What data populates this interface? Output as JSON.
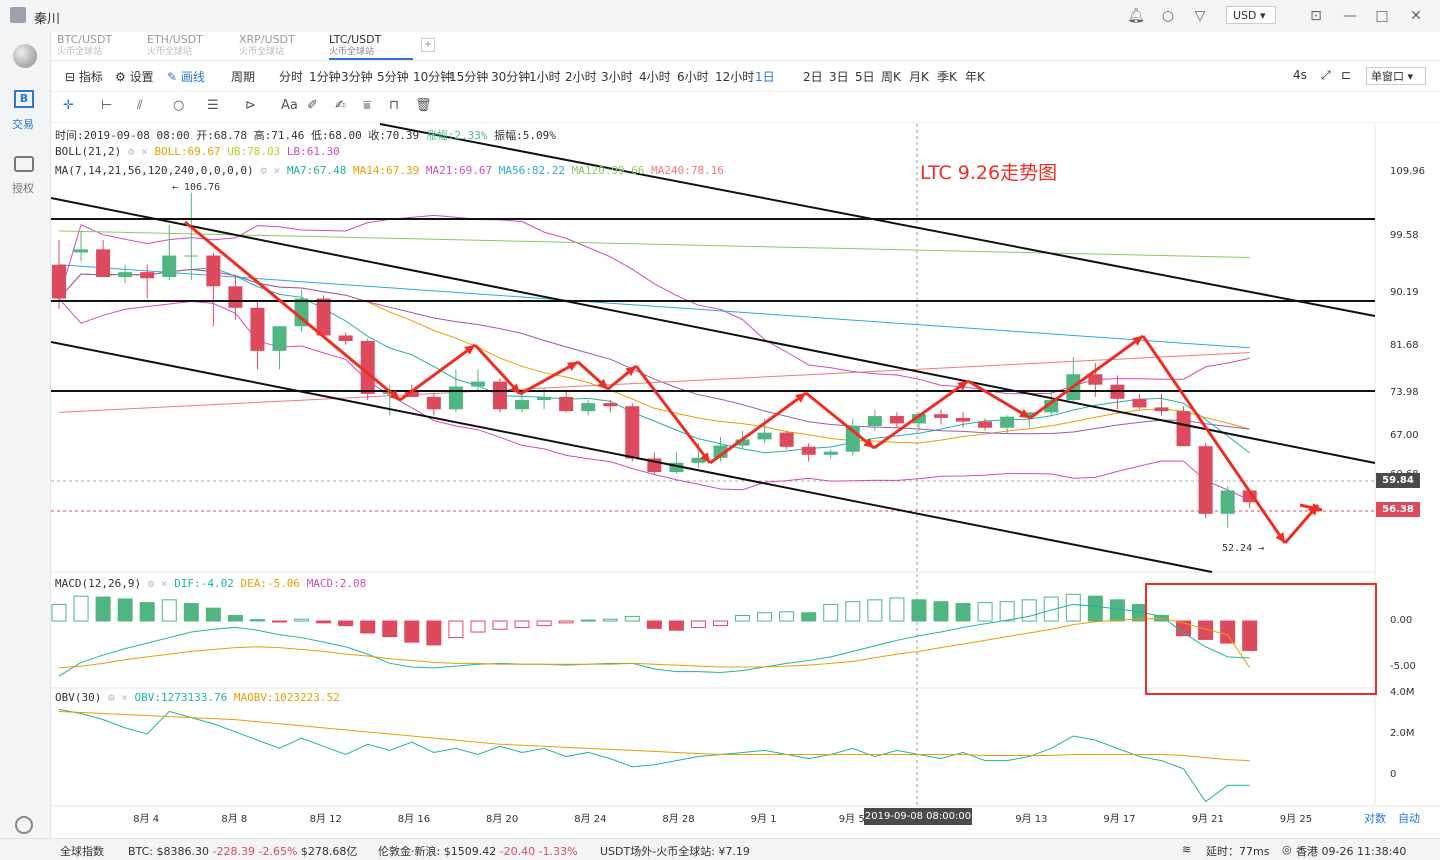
{
  "window": {
    "user": "秦川",
    "currency": "USD"
  },
  "sidebar": {
    "trade_label": "交易",
    "auth_label": "授权"
  },
  "tabs": [
    {
      "pair": "BTC/USDT",
      "exchange": "火币全球站"
    },
    {
      "pair": "ETH/USDT",
      "exchange": "火币全球站"
    },
    {
      "pair": "XRP/USDT",
      "exchange": "火币全球站"
    },
    {
      "pair": "LTC/USDT",
      "exchange": "火币全球站"
    }
  ],
  "toolbar": {
    "indicator": "指标",
    "settings": "设置",
    "draw": "画线",
    "period": "周期",
    "periods": [
      "分时",
      "1分钟",
      "3分钟",
      "5分钟",
      "10分钟",
      "15分钟",
      "30分钟",
      "1小时",
      "2小时",
      "3小时",
      "4小时",
      "6小时",
      "12小时",
      "1日",
      "2日",
      "3日",
      "5日",
      "周K",
      "月K",
      "季K",
      "年K"
    ],
    "active_period": "1日",
    "refresh": "4s",
    "window_mode": "单窗口"
  },
  "chart_data": {
    "type": "candlestick",
    "symbol": "LTC/USDT",
    "annotation": "LTC 9.26走势图",
    "info": {
      "time": "时间:2019-09-08 08:00",
      "open": "开:68.78",
      "high": "高:71.46",
      "low": "低:68.00",
      "close": "收:70.39",
      "change": "涨幅:2.33%",
      "amplitude": "振幅:5.09%"
    },
    "legends": {
      "boll": {
        "label": "BOLL(21,2)",
        "boll": "BOLL:69.67",
        "ub": "UB:78.03",
        "lb": "LB:61.30"
      },
      "ma": {
        "label": "MA(7,14,21,56,120,240,0,0,0,0)",
        "ma7": "MA7:67.48",
        "ma14": "MA14:67.39",
        "ma21": "MA21:69.67",
        "ma56": "MA56:82.22",
        "ma120": "MA120:99.66",
        "ma240": "MA240:78.16"
      },
      "macd": {
        "label": "MACD(12,26,9)",
        "dif": "DIF:-4.02",
        "dea": "DEA:-5.06",
        "macd": "MACD:2.08"
      },
      "obv": {
        "label": "OBV(30)",
        "obv": "OBV:1273133.76",
        "maobv": "MAOBV:1023223.52"
      }
    },
    "price_axis": [
      "109.96",
      "99.58",
      "90.19",
      "81.68",
      "73.98",
      "67.00",
      "60.68",
      "54.95"
    ],
    "price_tags": {
      "level": "59.84",
      "current": "56.38"
    },
    "high_label": "← 106.76",
    "low_label": "52.24 →",
    "macd_axis": [
      "0.00",
      "-5.00"
    ],
    "obv_axis": [
      "4.0M",
      "2.0M",
      "0"
    ],
    "x_axis": [
      "8月 4",
      "8月 8",
      "8月 12",
      "8月 16",
      "8月 20",
      "8月 24",
      "8月 28",
      "9月 1",
      "9月 5",
      "9月 13",
      "9月 17",
      "9月 21",
      "9月 25"
    ],
    "crosshair_label": "2019-09-08 08:00:00",
    "axis_buttons": {
      "log": "对数",
      "auto": "自动"
    },
    "candles": [
      [
        95.0,
        99.0,
        87.8,
        89.5
      ],
      [
        97.0,
        100.5,
        95.5,
        97.5
      ],
      [
        97.5,
        99.0,
        93.0,
        93.0
      ],
      [
        93.0,
        95.0,
        92.0,
        93.8
      ],
      [
        93.8,
        95.0,
        89.5,
        92.8
      ],
      [
        93.0,
        101.5,
        92.5,
        96.5
      ],
      [
        96.5,
        106.76,
        92.5,
        96.5
      ],
      [
        96.5,
        97.0,
        85.0,
        91.5
      ],
      [
        91.5,
        93.0,
        86.0,
        88.0
      ],
      [
        88.0,
        89.0,
        78.0,
        81.0
      ],
      [
        81.0,
        85.0,
        78.0,
        85.0
      ],
      [
        85.0,
        91.0,
        84.0,
        89.5
      ],
      [
        89.5,
        90.0,
        83.5,
        83.5
      ],
      [
        83.5,
        84.0,
        82.0,
        82.6
      ],
      [
        82.6,
        83.0,
        73.0,
        74.0
      ],
      [
        74.0,
        75.5,
        70.5,
        74.5
      ],
      [
        74.5,
        75.5,
        73.5,
        73.5
      ],
      [
        73.5,
        74.2,
        70.5,
        71.5
      ],
      [
        71.5,
        78.0,
        71.0,
        75.2
      ],
      [
        75.2,
        78.0,
        74.5,
        76.0
      ],
      [
        76.0,
        76.5,
        71.0,
        71.5
      ],
      [
        71.5,
        74.0,
        71.0,
        73.0
      ],
      [
        73.0,
        75.0,
        71.5,
        73.5
      ],
      [
        73.5,
        74.5,
        71.0,
        71.2
      ],
      [
        71.2,
        73.0,
        70.5,
        72.5
      ],
      [
        72.5,
        73.0,
        71.0,
        72.0
      ],
      [
        72.0,
        72.5,
        63.0,
        63.5
      ],
      [
        63.5,
        64.5,
        61.0,
        61.3
      ],
      [
        61.3,
        64.5,
        61.0,
        62.8
      ],
      [
        62.8,
        66.0,
        62.0,
        63.6
      ],
      [
        63.6,
        67.0,
        63.0,
        65.6
      ],
      [
        65.6,
        68.0,
        65.0,
        66.6
      ],
      [
        66.6,
        70.0,
        66.0,
        67.7
      ],
      [
        67.7,
        68.0,
        65.0,
        65.4
      ],
      [
        65.4,
        66.0,
        63.0,
        64.1
      ],
      [
        64.1,
        65.0,
        63.5,
        64.6
      ],
      [
        64.6,
        70.0,
        64.0,
        68.8
      ],
      [
        68.78,
        71.46,
        68.0,
        70.39
      ],
      [
        70.4,
        71.0,
        68.5,
        69.2
      ],
      [
        69.2,
        71.0,
        68.0,
        70.7
      ],
      [
        70.7,
        71.5,
        69.0,
        70.1
      ],
      [
        70.1,
        71.0,
        68.5,
        69.5
      ],
      [
        69.5,
        70.0,
        68.0,
        68.5
      ],
      [
        68.5,
        70.5,
        67.5,
        70.3
      ],
      [
        70.3,
        71.0,
        68.5,
        71.0
      ],
      [
        71.0,
        74.5,
        70.5,
        73.0
      ],
      [
        73.0,
        80.0,
        72.5,
        77.2
      ],
      [
        77.2,
        79.0,
        73.5,
        75.5
      ],
      [
        75.5,
        77.0,
        71.5,
        73.2
      ],
      [
        73.2,
        74.0,
        71.5,
        71.8
      ],
      [
        71.8,
        74.0,
        70.5,
        71.2
      ],
      [
        71.2,
        72.0,
        65.5,
        65.5
      ],
      [
        65.5,
        66.0,
        53.8,
        54.5
      ],
      [
        54.5,
        59.0,
        52.24,
        58.3
      ],
      [
        58.3,
        58.5,
        55.5,
        56.38
      ]
    ],
    "macd_hist": [
      1.8,
      2.7,
      2.6,
      2.4,
      2.0,
      2.3,
      1.9,
      1.4,
      0.6,
      0.15,
      -0.1,
      0.2,
      -0.2,
      -0.5,
      -1.3,
      -1.7,
      -2.3,
      -2.6,
      -1.8,
      -1.2,
      -0.9,
      -0.7,
      -0.5,
      -0.2,
      0.1,
      0.2,
      0.5,
      -0.8,
      -1.0,
      -0.7,
      -0.5,
      0.6,
      0.9,
      1.0,
      0.9,
      1.8,
      2.1,
      2.3,
      2.5,
      2.3,
      2.1,
      1.9,
      2.0,
      2.1,
      2.3,
      2.6,
      2.9,
      2.7,
      2.3,
      1.8,
      0.6,
      -1.6,
      -2.0,
      -2.4,
      -3.2
    ],
    "dif": [
      -6.0,
      -4.5,
      -3.7,
      -3.0,
      -2.4,
      -1.8,
      -1.2,
      -0.9,
      -0.7,
      -1.0,
      -1.5,
      -1.8,
      -2.3,
      -2.8,
      -3.6,
      -4.6,
      -5.0,
      -5.1,
      -4.9,
      -4.7,
      -4.6,
      -4.7,
      -4.7,
      -4.8,
      -4.7,
      -4.6,
      -4.6,
      -5.2,
      -5.5,
      -5.5,
      -5.6,
      -5.4,
      -5.0,
      -4.6,
      -4.3,
      -3.9,
      -3.3,
      -2.7,
      -2.1,
      -1.6,
      -1.2,
      -0.7,
      -0.3,
      0.1,
      0.5,
      1.2,
      1.8,
      1.6,
      1.3,
      1.0,
      0.5,
      -1.3,
      -2.8,
      -3.9,
      -4.02
    ],
    "dea": [
      -5.1,
      -4.9,
      -4.6,
      -4.2,
      -3.9,
      -3.6,
      -3.3,
      -3.1,
      -2.9,
      -2.8,
      -2.9,
      -3.1,
      -3.3,
      -3.6,
      -3.8,
      -4.1,
      -4.3,
      -4.5,
      -4.6,
      -4.6,
      -4.7,
      -4.7,
      -4.7,
      -4.7,
      -4.7,
      -4.7,
      -4.6,
      -4.7,
      -4.8,
      -4.9,
      -5.0,
      -5.0,
      -5.0,
      -4.9,
      -4.8,
      -4.6,
      -4.4,
      -4.0,
      -3.6,
      -3.3,
      -2.9,
      -2.5,
      -2.1,
      -1.7,
      -1.3,
      -0.9,
      -0.4,
      -0.1,
      0.1,
      0.2,
      0.3,
      -0.2,
      -0.9,
      -1.5,
      -5.06
    ],
    "obv": [
      3.2,
      3.0,
      2.7,
      2.3,
      2.0,
      3.1,
      2.8,
      2.5,
      2.1,
      1.7,
      1.3,
      1.8,
      1.4,
      1.0,
      1.5,
      1.2,
      1.6,
      1.1,
      1.3,
      1.0,
      1.4,
      1.1,
      1.3,
      0.9,
      1.1,
      0.8,
      0.4,
      0.5,
      0.7,
      0.9,
      1.0,
      1.1,
      1.2,
      1.0,
      0.8,
      1.0,
      1.3,
      0.9,
      1.2,
      1.0,
      0.8,
      1.1,
      0.7,
      0.7,
      0.9,
      1.3,
      1.9,
      1.7,
      1.3,
      0.9,
      0.7,
      0.3,
      -1.3,
      -0.5,
      -0.5
    ],
    "maobv": [
      3.1,
      3.05,
      3.0,
      2.95,
      2.9,
      2.85,
      2.8,
      2.75,
      2.7,
      2.6,
      2.5,
      2.4,
      2.3,
      2.2,
      2.1,
      2.0,
      1.9,
      1.8,
      1.7,
      1.6,
      1.5,
      1.45,
      1.4,
      1.35,
      1.3,
      1.25,
      1.2,
      1.15,
      1.1,
      1.05,
      1.0,
      1.0,
      1.0,
      1.0,
      1.0,
      1.0,
      1.0,
      1.0,
      1.0,
      1.0,
      1.0,
      1.0,
      0.95,
      0.95,
      0.95,
      0.95,
      1.0,
      1.0,
      1.0,
      1.0,
      1.0,
      0.95,
      0.85,
      0.75,
      0.7
    ]
  },
  "colors": {
    "up": "#4fb682",
    "down": "#dd4a5d",
    "arrow": "#ee2e24",
    "accent": "#2a76d2"
  },
  "status": {
    "index": "全球指数",
    "btc_label": "BTC:",
    "btc_price": "$8386.30",
    "btc_change": "-228.39",
    "btc_pct": "-2.65%",
    "btc_cap": "$278.68亿",
    "gold_label": "伦敦金·新浪:",
    "gold_price": "$1509.42",
    "gold_change": "-20.40",
    "gold_pct": "-1.33%",
    "usdt_label": "USDT场外-火币全球站:",
    "usdt_price": "¥7.19",
    "latency": "延时：77ms",
    "clock": "香港 09-26 11:38:40"
  }
}
